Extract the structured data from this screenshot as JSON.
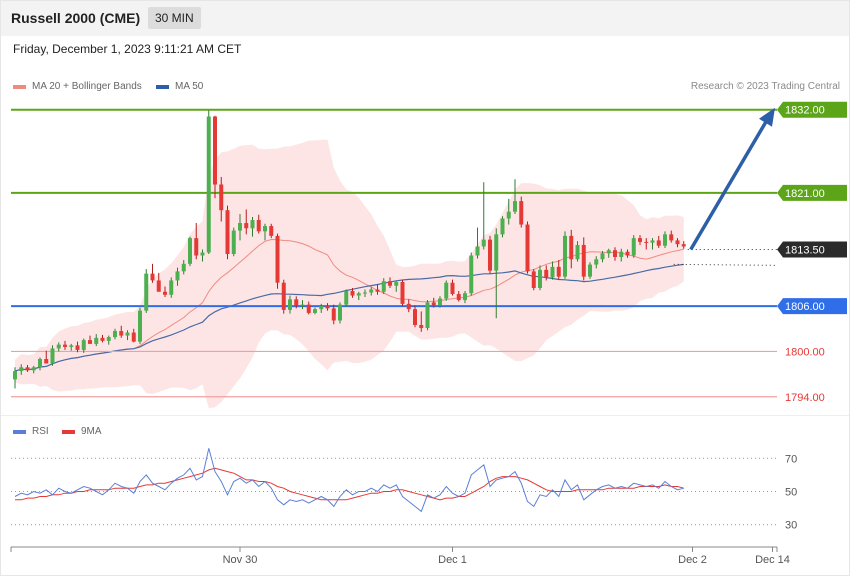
{
  "header": {
    "title": "Russell 2000 (CME)",
    "timeframe": "30 MIN",
    "datetime": "Friday, December 1, 2023 9:11:21 AM CET"
  },
  "legend": {
    "ma20": "MA 20 + Bollinger Bands",
    "ma50": "MA 50",
    "rsi": "RSI",
    "ma9": "9MA"
  },
  "research": "Research © 2023 Trading Central",
  "colors": {
    "up": "#4caf50",
    "down": "#e53935",
    "band": "#fde0e0",
    "ma20": "#f08a80",
    "ma50": "#4a6aa5",
    "resistance": "#5ca518",
    "pivot": "#2f6ee8",
    "support": "#f0a0a0",
    "arrow": "#2d5fa8",
    "rsi": "#5b7fd8",
    "rsi_ma": "#e53935"
  },
  "chart_data": {
    "type": "candlestick",
    "y_range": [
      1791.85,
      1833.95
    ],
    "price_labels": [
      "1832.00",
      "1821.00",
      "1813.50",
      "1806.00",
      "1800.00",
      "1794.00"
    ],
    "levels": [
      {
        "name": "resistance-2",
        "value": 1832.0,
        "label": "1832.00",
        "kind": "resistance"
      },
      {
        "name": "resistance-1",
        "value": 1821.0,
        "label": "1821.00",
        "kind": "resistance"
      },
      {
        "name": "last-price",
        "value": 1813.5,
        "label": "1813.50",
        "kind": "last"
      },
      {
        "name": "pivot",
        "value": 1806.0,
        "label": "1806.00",
        "kind": "pivot"
      },
      {
        "name": "support-1",
        "value": 1800.0,
        "label": "1800.00",
        "kind": "support"
      },
      {
        "name": "support-2",
        "value": 1794.0,
        "label": "1794.00",
        "kind": "support"
      }
    ],
    "projection": {
      "from": 1813.5,
      "to": 1832.0
    },
    "candles": [
      [
        1796.3,
        1797.9,
        1795.1,
        1797.4
      ],
      [
        1797.4,
        1798.3,
        1796.9,
        1797.9
      ],
      [
        1797.9,
        1798.2,
        1797.3,
        1797.5
      ],
      [
        1797.5,
        1798.1,
        1797.1,
        1797.9
      ],
      [
        1797.9,
        1799.2,
        1797.5,
        1799.0
      ],
      [
        1799.0,
        1800.1,
        1798.7,
        1798.4
      ],
      [
        1798.4,
        1800.8,
        1798.1,
        1800.4
      ],
      [
        1800.4,
        1801.2,
        1800.0,
        1800.9
      ],
      [
        1800.9,
        1801.4,
        1800.2,
        1800.6
      ],
      [
        1800.6,
        1801.0,
        1800.1,
        1800.8
      ],
      [
        1800.8,
        1801.3,
        1799.9,
        1800.2
      ],
      [
        1800.2,
        1801.7,
        1799.8,
        1801.5
      ],
      [
        1801.5,
        1802.1,
        1801.1,
        1801.0
      ],
      [
        1801.0,
        1802.3,
        1800.7,
        1801.8
      ],
      [
        1801.8,
        1802.2,
        1801.2,
        1801.4
      ],
      [
        1801.4,
        1802.1,
        1800.9,
        1801.9
      ],
      [
        1801.9,
        1803.0,
        1801.6,
        1802.7
      ],
      [
        1802.7,
        1803.4,
        1801.8,
        1802.1
      ],
      [
        1802.1,
        1802.8,
        1801.5,
        1802.5
      ],
      [
        1802.5,
        1803.0,
        1801.2,
        1801.3
      ],
      [
        1801.3,
        1805.8,
        1801.0,
        1805.4
      ],
      [
        1805.4,
        1810.9,
        1805.1,
        1810.3
      ],
      [
        1810.3,
        1811.6,
        1809.1,
        1809.4
      ],
      [
        1809.4,
        1810.4,
        1808.3,
        1807.9
      ],
      [
        1807.9,
        1808.6,
        1807.2,
        1807.5
      ],
      [
        1807.5,
        1809.8,
        1807.1,
        1809.4
      ],
      [
        1809.4,
        1811.1,
        1808.7,
        1810.6
      ],
      [
        1810.6,
        1812.1,
        1810.2,
        1811.6
      ],
      [
        1811.6,
        1815.2,
        1811.3,
        1815.0
      ],
      [
        1815.0,
        1817.0,
        1812.2,
        1812.7
      ],
      [
        1812.7,
        1813.5,
        1811.9,
        1813.1
      ],
      [
        1813.1,
        1831.9,
        1812.9,
        1831.1
      ],
      [
        1831.1,
        1831.2,
        1820.3,
        1822.1
      ],
      [
        1822.1,
        1823.1,
        1817.2,
        1818.7
      ],
      [
        1818.7,
        1819.3,
        1812.2,
        1812.9
      ],
      [
        1812.9,
        1816.4,
        1812.6,
        1816.0
      ],
      [
        1816.0,
        1818.2,
        1814.7,
        1817.0
      ],
      [
        1817.0,
        1818.8,
        1815.5,
        1816.3
      ],
      [
        1816.3,
        1817.8,
        1815.2,
        1817.4
      ],
      [
        1817.4,
        1818.1,
        1815.6,
        1815.9
      ],
      [
        1815.9,
        1816.9,
        1814.7,
        1816.6
      ],
      [
        1816.6,
        1816.9,
        1815.0,
        1815.3
      ],
      [
        1815.3,
        1815.6,
        1808.3,
        1809.1
      ],
      [
        1809.1,
        1809.5,
        1805.0,
        1805.5
      ],
      [
        1805.5,
        1807.4,
        1805.0,
        1806.9
      ],
      [
        1806.9,
        1807.3,
        1805.7,
        1806.1
      ],
      [
        1806.1,
        1806.8,
        1805.6,
        1806.2
      ],
      [
        1806.2,
        1806.6,
        1804.9,
        1805.1
      ],
      [
        1805.1,
        1805.8,
        1804.9,
        1805.6
      ],
      [
        1805.6,
        1806.3,
        1805.1,
        1806.0
      ],
      [
        1806.0,
        1806.4,
        1805.4,
        1805.7
      ],
      [
        1805.7,
        1806.2,
        1803.6,
        1804.1
      ],
      [
        1804.1,
        1806.5,
        1803.7,
        1806.2
      ],
      [
        1806.2,
        1808.2,
        1805.9,
        1808.0
      ],
      [
        1808.0,
        1808.4,
        1807.1,
        1807.4
      ],
      [
        1807.4,
        1807.9,
        1806.8,
        1807.7
      ],
      [
        1807.7,
        1808.2,
        1807.2,
        1807.8
      ],
      [
        1807.8,
        1808.5,
        1807.4,
        1808.2
      ],
      [
        1808.2,
        1808.9,
        1807.5,
        1807.9
      ],
      [
        1807.9,
        1809.7,
        1807.6,
        1809.3
      ],
      [
        1809.3,
        1809.8,
        1808.4,
        1808.7
      ],
      [
        1808.7,
        1809.3,
        1807.9,
        1809.2
      ],
      [
        1809.2,
        1809.5,
        1806.0,
        1806.3
      ],
      [
        1806.3,
        1806.9,
        1805.2,
        1805.6
      ],
      [
        1805.6,
        1806.1,
        1803.2,
        1803.5
      ],
      [
        1803.5,
        1805.3,
        1802.6,
        1803.1
      ],
      [
        1803.1,
        1806.8,
        1802.8,
        1806.5
      ],
      [
        1806.5,
        1807.1,
        1805.8,
        1806.1
      ],
      [
        1806.1,
        1807.3,
        1805.8,
        1807.0
      ],
      [
        1807.0,
        1809.4,
        1806.7,
        1809.1
      ],
      [
        1809.1,
        1809.5,
        1807.4,
        1807.6
      ],
      [
        1807.6,
        1808.0,
        1806.6,
        1806.8
      ],
      [
        1806.8,
        1808.0,
        1806.4,
        1807.7
      ],
      [
        1807.7,
        1813.1,
        1807.4,
        1812.7
      ],
      [
        1812.7,
        1816.4,
        1812.3,
        1813.9
      ],
      [
        1813.9,
        1822.4,
        1813.5,
        1814.8
      ],
      [
        1814.8,
        1815.3,
        1810.3,
        1810.7
      ],
      [
        1810.7,
        1816.3,
        1804.4,
        1815.5
      ],
      [
        1815.5,
        1817.9,
        1815.1,
        1817.6
      ],
      [
        1817.6,
        1820.2,
        1816.8,
        1818.5
      ],
      [
        1818.5,
        1822.8,
        1818.2,
        1819.9
      ],
      [
        1819.9,
        1820.5,
        1816.4,
        1816.8
      ],
      [
        1816.8,
        1817.2,
        1810.3,
        1810.6
      ],
      [
        1810.6,
        1810.9,
        1808.1,
        1808.4
      ],
      [
        1808.4,
        1811.4,
        1808.1,
        1810.8
      ],
      [
        1810.8,
        1811.4,
        1809.4,
        1809.8
      ],
      [
        1809.8,
        1811.9,
        1809.5,
        1811.2
      ],
      [
        1811.2,
        1812.1,
        1809.5,
        1809.9
      ],
      [
        1809.9,
        1815.9,
        1809.6,
        1815.3
      ],
      [
        1815.3,
        1816.1,
        1811.0,
        1812.2
      ],
      [
        1812.2,
        1814.6,
        1811.9,
        1814.1
      ],
      [
        1814.1,
        1815.1,
        1809.4,
        1809.9
      ],
      [
        1809.9,
        1811.8,
        1809.6,
        1811.5
      ],
      [
        1811.5,
        1812.6,
        1811.0,
        1812.2
      ],
      [
        1812.2,
        1813.3,
        1811.8,
        1813.0
      ],
      [
        1813.0,
        1813.6,
        1812.4,
        1813.4
      ],
      [
        1813.4,
        1813.8,
        1812.0,
        1812.5
      ],
      [
        1812.5,
        1813.6,
        1811.9,
        1813.2
      ],
      [
        1813.2,
        1813.5,
        1812.4,
        1812.7
      ],
      [
        1812.7,
        1815.4,
        1812.4,
        1815.0
      ],
      [
        1815.0,
        1815.4,
        1814.1,
        1814.5
      ],
      [
        1814.5,
        1815.0,
        1813.5,
        1814.4
      ],
      [
        1814.4,
        1815.0,
        1813.5,
        1814.7
      ],
      [
        1814.7,
        1815.3,
        1813.7,
        1814.0
      ],
      [
        1814.0,
        1815.9,
        1813.7,
        1815.5
      ],
      [
        1815.5,
        1816.0,
        1814.4,
        1814.7
      ],
      [
        1814.7,
        1815.0,
        1813.8,
        1814.2
      ],
      [
        1814.2,
        1814.6,
        1813.6,
        1813.9
      ]
    ],
    "rsi": {
      "axis_labels": [
        "70",
        "50",
        "30"
      ],
      "range": [
        22,
        78
      ],
      "values": [
        47,
        49,
        48,
        50,
        49,
        51,
        48,
        52,
        50,
        49,
        51,
        53,
        52,
        50,
        48,
        51,
        55,
        53,
        52,
        49,
        56,
        60,
        55,
        53,
        51,
        55,
        58,
        60,
        64,
        57,
        59,
        76,
        62,
        56,
        48,
        56,
        58,
        55,
        57,
        53,
        56,
        52,
        45,
        42,
        45,
        44,
        45,
        43,
        45,
        47,
        45,
        41,
        47,
        51,
        48,
        50,
        50,
        52,
        50,
        54,
        52,
        54,
        47,
        44,
        41,
        38,
        48,
        46,
        48,
        53,
        49,
        47,
        49,
        60,
        63,
        66,
        53,
        57,
        58,
        59,
        62,
        55,
        44,
        41,
        48,
        47,
        51,
        47,
        57,
        51,
        54,
        45,
        48,
        51,
        53,
        54,
        52,
        53,
        52,
        55,
        54,
        53,
        54,
        52,
        56,
        53,
        51,
        52
      ],
      "ma9": [
        45,
        45,
        46,
        46,
        47,
        47,
        48,
        48,
        49,
        49,
        50,
        50,
        51,
        51,
        51,
        51,
        52,
        52,
        52,
        52,
        53,
        54,
        54,
        55,
        55,
        56,
        57,
        58,
        59,
        60,
        61,
        63,
        64,
        63,
        62,
        61,
        59,
        57,
        57,
        56,
        56,
        55,
        53,
        52,
        50,
        49,
        48,
        47,
        46,
        45,
        45,
        45,
        45,
        45,
        46,
        47,
        48,
        49,
        49,
        50,
        50,
        51,
        51,
        50,
        49,
        48,
        47,
        46,
        45,
        46,
        46,
        47,
        47,
        49,
        51,
        53,
        56,
        58,
        59,
        59,
        59,
        58,
        57,
        55,
        53,
        51,
        50,
        50,
        50,
        50,
        51,
        51,
        51,
        51,
        51,
        52,
        52,
        52,
        52,
        52,
        53,
        53,
        53,
        53,
        54,
        53,
        53,
        52
      ]
    },
    "x_ticks": [
      {
        "label": "Nov 30",
        "index": 36
      },
      {
        "label": "Dec 1",
        "index": 70
      },
      {
        "label": "Dec 2",
        "index": 82
      },
      {
        "label": "Dec 14",
        "index": 90
      }
    ],
    "grid": false
  }
}
